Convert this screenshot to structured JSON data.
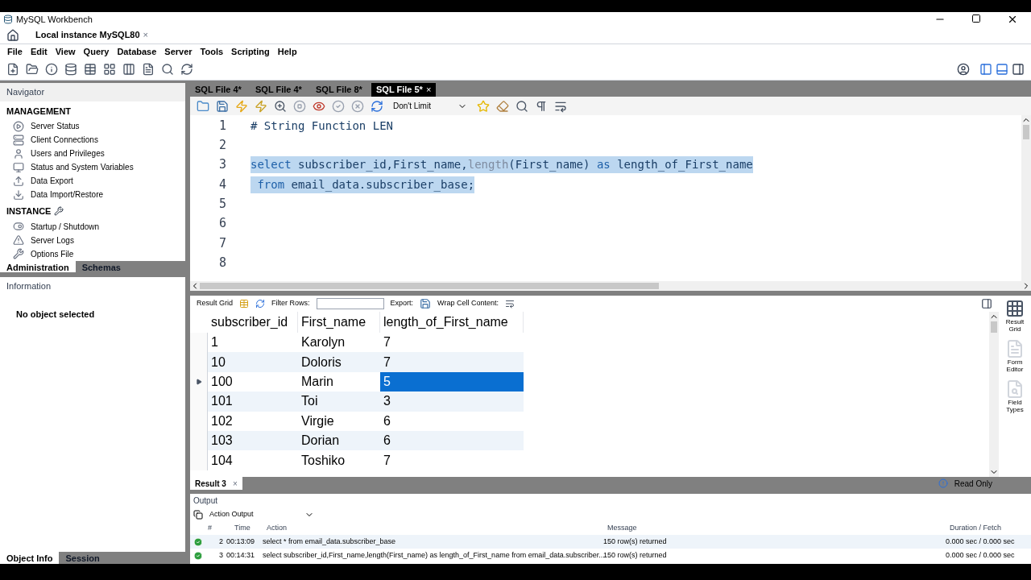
{
  "window": {
    "title": "MySQL Workbench"
  },
  "connection_tab": {
    "label": "Local instance MySQL80",
    "close": "×"
  },
  "menu": [
    "File",
    "Edit",
    "View",
    "Query",
    "Database",
    "Server",
    "Tools",
    "Scripting",
    "Help"
  ],
  "navigator": {
    "title": "Navigator",
    "sections": [
      {
        "heading": "MANAGEMENT",
        "items": [
          "Server Status",
          "Client Connections",
          "Users and Privileges",
          "Status and System Variables",
          "Data Export",
          "Data Import/Restore"
        ]
      },
      {
        "heading": "INSTANCE",
        "items": [
          "Startup / Shutdown",
          "Server Logs",
          "Options File"
        ]
      }
    ],
    "tabs": [
      {
        "label": "Administration",
        "selected": true
      },
      {
        "label": "Schemas",
        "selected": false
      }
    ]
  },
  "information": {
    "title": "Information",
    "message": "No object selected",
    "tabs": [
      {
        "label": "Object Info",
        "selected": true
      },
      {
        "label": "Session",
        "selected": false
      }
    ]
  },
  "sql_tabs": [
    {
      "label": "SQL File 4*",
      "selected": false
    },
    {
      "label": "SQL File 4*",
      "selected": false
    },
    {
      "label": "SQL File 8*",
      "selected": false
    },
    {
      "label": "SQL File 5*",
      "selected": true,
      "close": "×"
    }
  ],
  "limit": {
    "value": "Don't Limit"
  },
  "editor": {
    "lines": [
      {
        "number": "1",
        "selected": false,
        "tokens": [
          {
            "kind": "comment",
            "text": "# String Function LEN"
          }
        ]
      },
      {
        "number": "2"
      },
      {
        "number": "3",
        "selected": true,
        "tokens": [
          {
            "kind": "keyword",
            "text": "select"
          },
          {
            "kind": "plain",
            "text": " subscriber_id,First_name,"
          },
          {
            "kind": "function",
            "text": "length"
          },
          {
            "kind": "plain",
            "text": "(First_name) "
          },
          {
            "kind": "keyword",
            "text": "as"
          },
          {
            "kind": "plain",
            "text": " length_of_First_name"
          }
        ]
      },
      {
        "number": "4",
        "selected": true,
        "tokens": [
          {
            "kind": "keyword",
            "text": " from"
          },
          {
            "kind": "plain",
            "text": " email_data.subscriber_base;"
          }
        ]
      },
      {
        "number": "5"
      },
      {
        "number": "6"
      },
      {
        "number": "7"
      },
      {
        "number": "8"
      }
    ]
  },
  "result_toolbar": {
    "result_grid": "Result Grid",
    "filter_label": "Filter Rows:",
    "export_label": "Export:",
    "wrap_label": "Wrap Cell Content:"
  },
  "grid": {
    "columns": [
      "subscriber_id",
      "First_name",
      "length_of_First_name"
    ],
    "rows": [
      {
        "current": false,
        "cells": [
          {
            "text": "1",
            "selected": false
          },
          {
            "text": "Karolyn",
            "selected": false
          },
          {
            "text": "7",
            "selected": false
          }
        ]
      },
      {
        "current": false,
        "cells": [
          {
            "text": "10",
            "selected": false
          },
          {
            "text": "Doloris",
            "selected": false
          },
          {
            "text": "7",
            "selected": false
          }
        ]
      },
      {
        "current": true,
        "cells": [
          {
            "text": "100",
            "selected": false
          },
          {
            "text": "Marin",
            "selected": false
          },
          {
            "text": "5",
            "selected": true
          }
        ]
      },
      {
        "current": false,
        "cells": [
          {
            "text": "101",
            "selected": false
          },
          {
            "text": "Toi",
            "selected": false
          },
          {
            "text": "3",
            "selected": false
          }
        ]
      },
      {
        "current": false,
        "cells": [
          {
            "text": "102",
            "selected": false
          },
          {
            "text": "Virgie",
            "selected": false
          },
          {
            "text": "6",
            "selected": false
          }
        ]
      },
      {
        "current": false,
        "cells": [
          {
            "text": "103",
            "selected": false
          },
          {
            "text": "Dorian",
            "selected": false
          },
          {
            "text": "6",
            "selected": false
          }
        ]
      },
      {
        "current": false,
        "cells": [
          {
            "text": "104",
            "selected": false
          },
          {
            "text": "Toshiko",
            "selected": false
          },
          {
            "text": "7",
            "selected": false
          }
        ]
      }
    ]
  },
  "side_views": [
    {
      "label": "Result Grid",
      "selected": true
    },
    {
      "label": "Form Editor",
      "selected": false
    },
    {
      "label": "Field Types",
      "selected": false
    }
  ],
  "result_tab": {
    "label": "Result 3",
    "close": "×",
    "status": "Read Only"
  },
  "output": {
    "title": "Output",
    "mode": "Action Output",
    "columns": [
      "#",
      "Time",
      "Action",
      "Message",
      "Duration / Fetch"
    ],
    "rows": [
      {
        "ok": true,
        "number": "2",
        "time": "00:13:09",
        "action": "select * from email_data.subscriber_base",
        "message": "150 row(s) returned",
        "duration": "0.000 sec / 0.000 sec"
      },
      {
        "ok": true,
        "number": "3",
        "time": "00:14:31",
        "action": "select subscriber_id,First_name,length(First_name) as length_of_First_name  from email_data.subscriber...",
        "message": "150 row(s) returned",
        "duration": "0.000 sec / 0.000 sec"
      }
    ]
  }
}
